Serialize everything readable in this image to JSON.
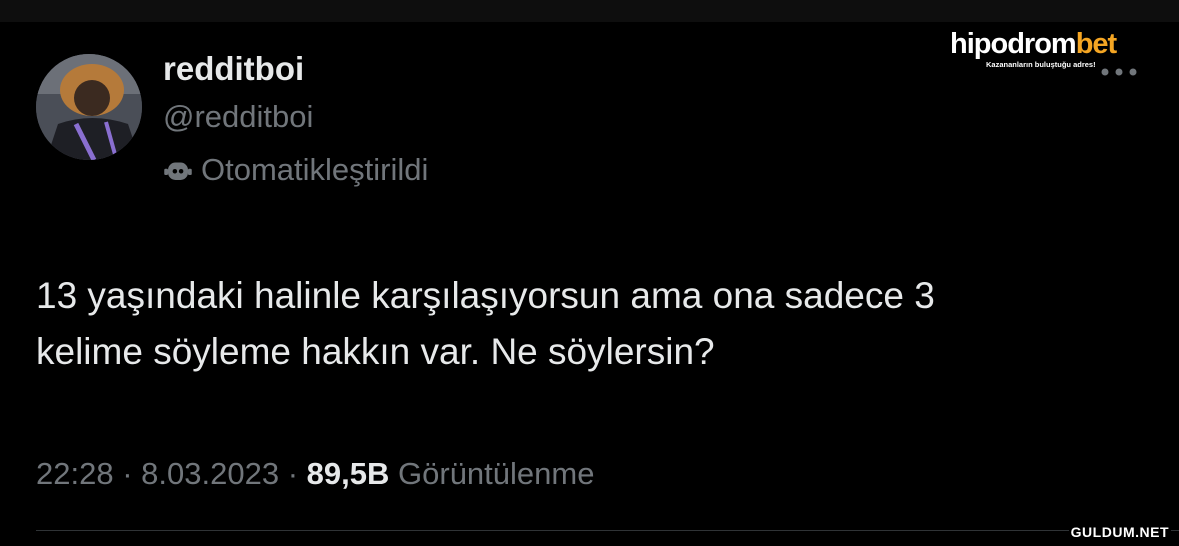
{
  "tweet": {
    "display_name": "redditboi",
    "handle": "@redditboi",
    "automated_label": "Otomatikleştirildi",
    "text_line_1": "13 yaşındaki halinle karşılaşıyorsun ama ona sadece 3",
    "text_line_2": "kelime söyleme hakkın var. Ne söylersin?",
    "time": "22:28",
    "date": "8.03.2023",
    "separator": "·",
    "view_count": "89,5B",
    "views_label": "Görüntülenme"
  },
  "overlay": {
    "logo_main": "hipodrom",
    "logo_accent": "bet",
    "logo_tagline": "Kazananların buluştuğu adres!",
    "watermark": "GULDUM.NET"
  },
  "icons": {
    "avatar": "profile-photo",
    "automated": "bot-icon",
    "more": "more-options-icon"
  },
  "colors": {
    "background": "#000000",
    "primary_text": "#e7e9ea",
    "secondary_text": "#71767b",
    "logo_accent": "#f5a623"
  }
}
